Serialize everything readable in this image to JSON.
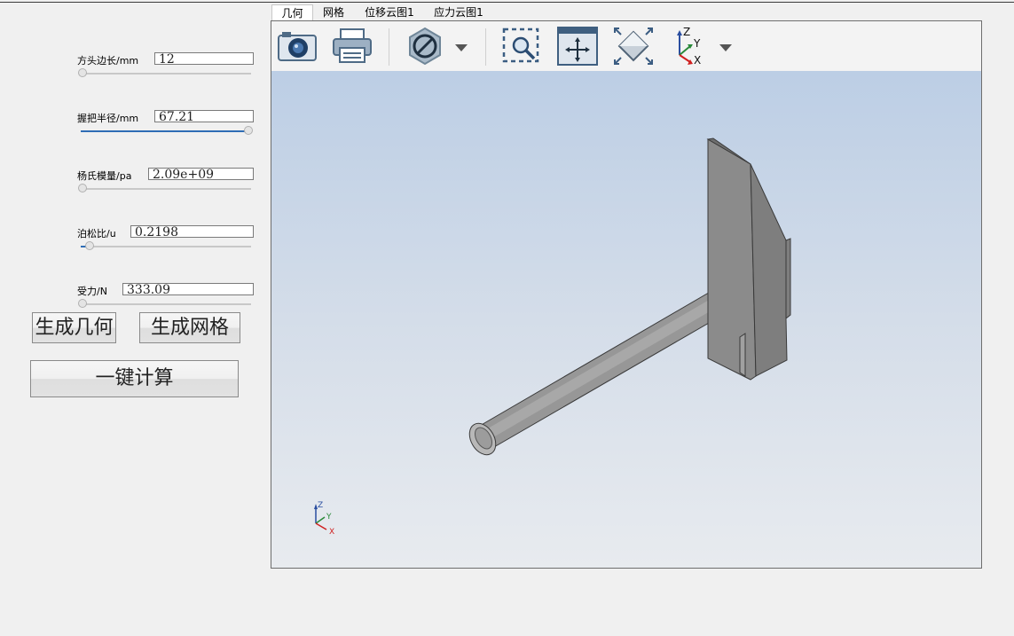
{
  "params": [
    {
      "label": "方头边长/mm",
      "value": "12",
      "fill": 0.0
    },
    {
      "label": "握把半径/mm",
      "value": "67.21",
      "fill": 1.0
    },
    {
      "label": "杨氏模量/pa",
      "value": "2.09e+09",
      "fill": 0.0
    },
    {
      "label": "泊松比/u",
      "value": "0.2198",
      "fill": 0.05
    },
    {
      "label": "受力/N",
      "value": "333.09",
      "fill": 0.0
    }
  ],
  "buttons": {
    "gen_geometry": "生成几何",
    "gen_mesh": "生成网格",
    "compute": "一键计算"
  },
  "tabs": [
    "几何",
    "网格",
    "位移云图1",
    "应力云图1"
  ],
  "active_tab": 0,
  "toolbar_icons": [
    "camera-icon",
    "printer-icon",
    "hide-icon",
    "dropdown-arrow-icon",
    "zoom-box-icon",
    "fit-all-icon",
    "view-iso-icon",
    "axis-view-icon",
    "dropdown-arrow-icon"
  ],
  "axes": {
    "x": "X",
    "y": "Y",
    "z": "Z"
  },
  "colors": {
    "accent": "#2f6db5",
    "model": "#8a8a8a",
    "bg_top": "#bccee5",
    "bg_bottom": "#e8ebef"
  }
}
